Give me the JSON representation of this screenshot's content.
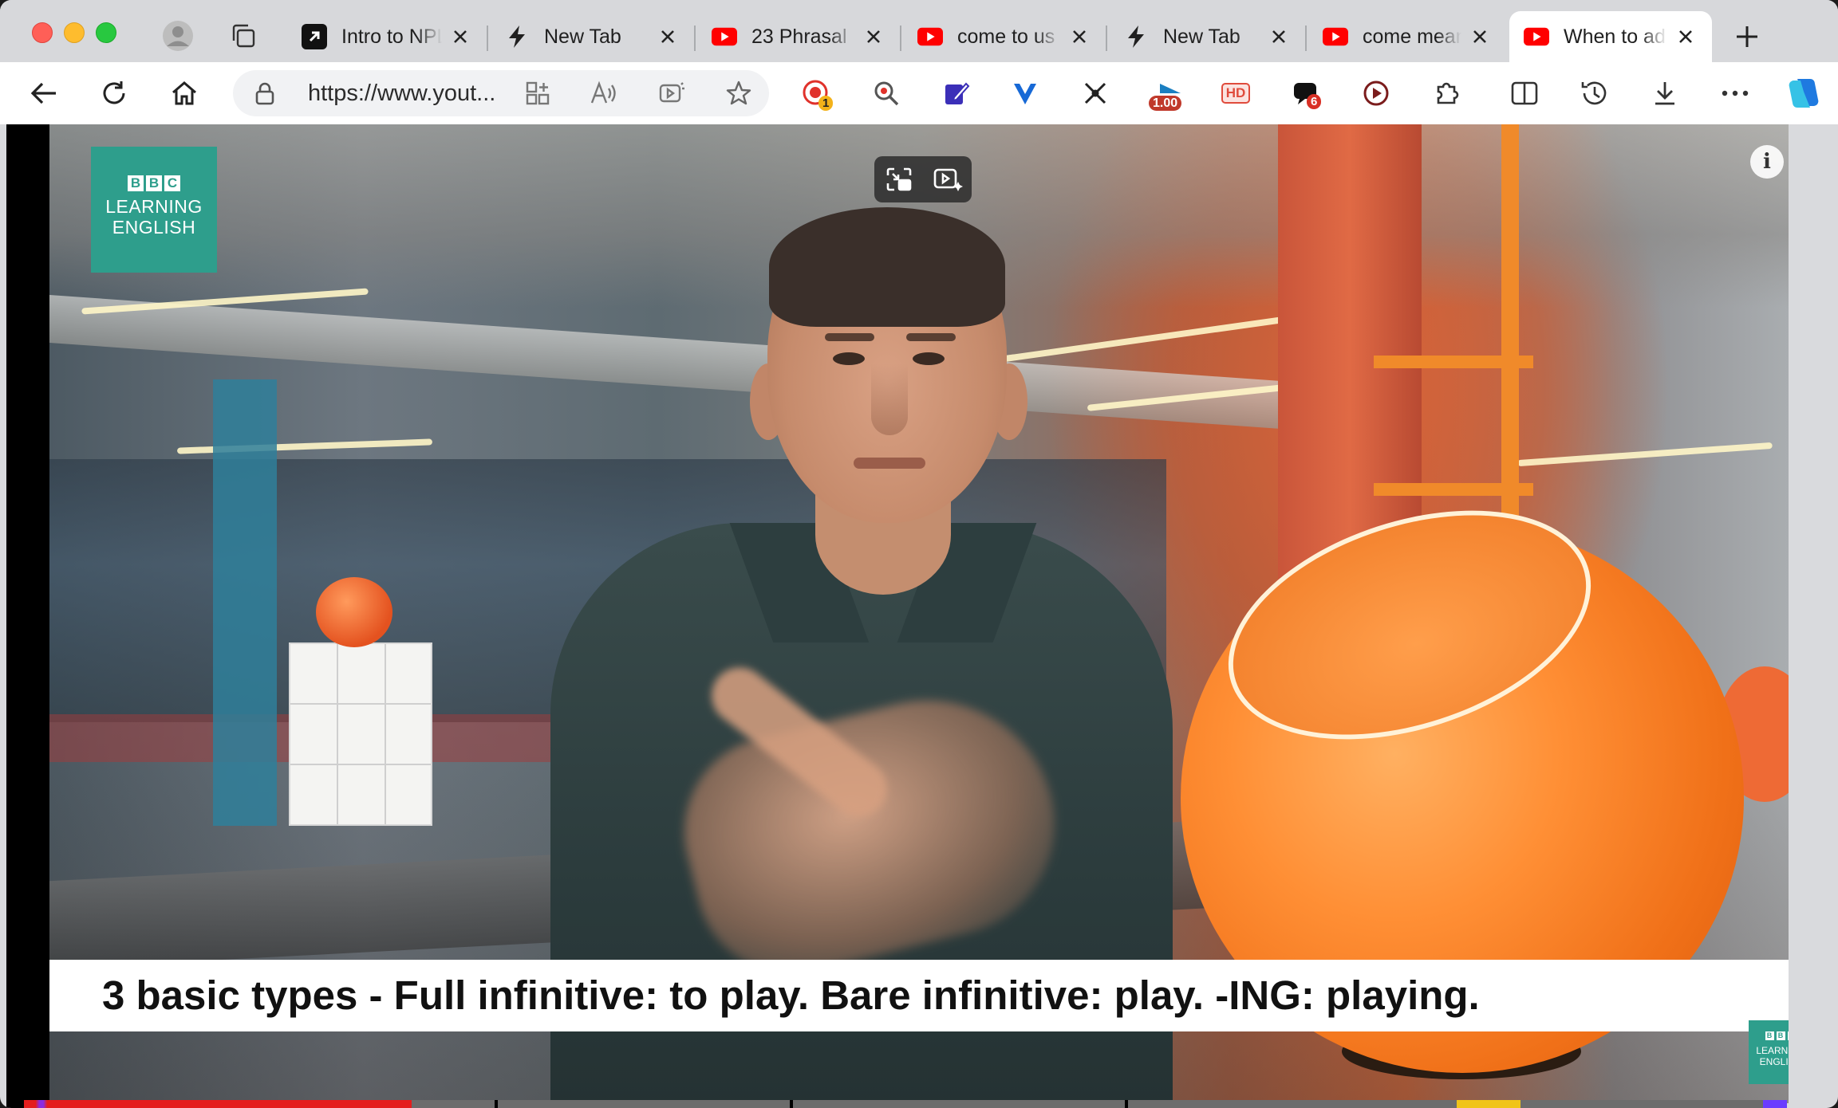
{
  "browser": {
    "tabs": [
      {
        "title": "Intro to NPL",
        "favicon": "arrow-up-right-icon",
        "close": "×"
      },
      {
        "title": "New Tab",
        "favicon": "lightning-icon",
        "close": "×"
      },
      {
        "title": "23 Phrasal",
        "favicon": "youtube-icon",
        "close": "×"
      },
      {
        "title": "come to us",
        "favicon": "youtube-icon",
        "close": "×"
      },
      {
        "title": "New Tab",
        "favicon": "lightning-icon",
        "close": "×"
      },
      {
        "title": "come mean",
        "favicon": "youtube-icon",
        "close": "×"
      },
      {
        "title": "When to ad",
        "favicon": "youtube-icon",
        "close": "×",
        "active": true
      }
    ],
    "new_tab": "+",
    "address_bar": {
      "url": "https://www.yout..."
    },
    "extension_badges": {
      "recorder": "1",
      "speed": "1.00",
      "hd": "HD",
      "notes": "6"
    },
    "colors": {
      "youtube_red": "#ff0000",
      "tab_active": "#ffffff",
      "tabstrip": "#d7d8db",
      "accent_copilot": "#1f7ae0"
    }
  },
  "video": {
    "logo": {
      "blocks": [
        "B",
        "B",
        "C"
      ],
      "line1": "LEARNING",
      "line2": "ENGLISH"
    },
    "info": "i",
    "caption": "3 basic types - Full infinitive: to play. Bare infinitive: play. -ING: playing.",
    "progress": 0.22,
    "colors": {
      "logo_teal": "#2e9e8c",
      "caption_bg": "#ffffff",
      "progress_red": "#e41d1d"
    }
  }
}
